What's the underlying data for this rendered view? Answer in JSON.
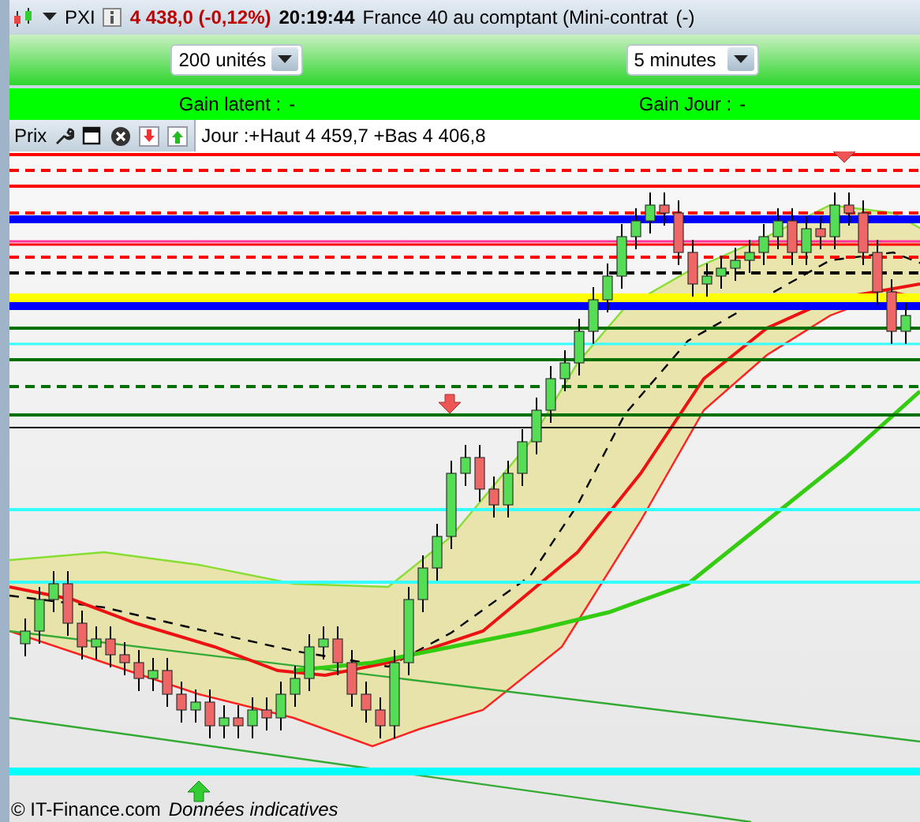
{
  "header": {
    "symbol": "PXI",
    "price_change": "4 438,0 (-0,12%)",
    "time": "20:19:44",
    "instrument": "France 40 au comptant (Mini-contrat",
    "status": "(-)"
  },
  "dropdowns": [
    {
      "value": "200 unités"
    },
    {
      "value": "5 minutes"
    }
  ],
  "gains": [
    {
      "label": "Gain latent :",
      "value": "-"
    },
    {
      "label": "Gain Jour :",
      "value": "-"
    }
  ],
  "toolbar": {
    "label": "Prix",
    "summary": "Jour :+Haut 4 459,7 +Bas 4 406,8"
  },
  "footer": {
    "copyright": "© IT-Finance.com",
    "note": "Données indicatives"
  }
}
